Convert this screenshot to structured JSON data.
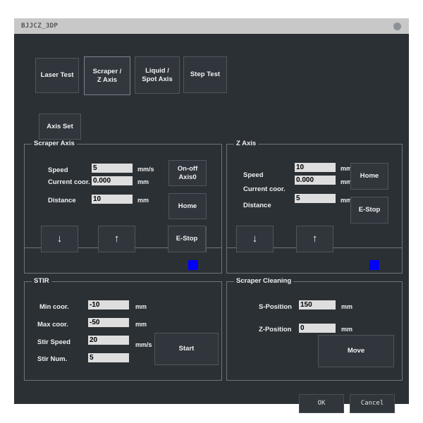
{
  "window": {
    "title": "BJJCZ_3DP",
    "titlebar_button": "titlebar-dot"
  },
  "tabs": [
    {
      "label": "Laser Test",
      "selected": false
    },
    {
      "label": "Scraper /\nZ Axis",
      "selected": true
    },
    {
      "label": "Liquid /\nSpot Axis",
      "selected": false
    },
    {
      "label": "Step Test",
      "selected": false
    }
  ],
  "toolbar": {
    "axis_set_label": "Axis Set"
  },
  "scraper_axis": {
    "title": "Scraper Axis",
    "speed_label": "Speed",
    "speed_value": "5",
    "speed_unit": "mm/s",
    "current_coor_label": "Current coor.",
    "current_coor_value": "0.000",
    "current_coor_unit": "mm",
    "distance_label": "Distance",
    "distance_value": "10",
    "distance_unit": "mm",
    "onoff_label": "On-off\nAxis0",
    "home_label": "Home",
    "estop_label": "E-Stop",
    "down_arrow": "↓",
    "up_arrow": "↑",
    "indicator_color": "#0000ff"
  },
  "z_axis": {
    "title": "Z Axis",
    "speed_label": "Speed",
    "speed_value": "10",
    "speed_unit": "mm/s",
    "current_coor_label": "Current coor.",
    "current_coor_value": "0.000",
    "current_coor_unit": "mm",
    "distance_label": "Distance",
    "distance_value": "5",
    "distance_unit": "mm",
    "home_label": "Home",
    "estop_label": "E-Stop",
    "down_arrow": "↓",
    "up_arrow": "↑",
    "indicator_color": "#0000ff"
  },
  "stir": {
    "title": "STIR",
    "min_coor_label": "Min coor.",
    "min_coor_value": "-10",
    "min_coor_unit": "mm",
    "max_coor_label": "Max coor.",
    "max_coor_value": "-50",
    "max_coor_unit": "mm",
    "stir_speed_label": "Stir Speed",
    "stir_speed_value": "20",
    "stir_speed_unit": "mm/s",
    "stir_num_label": "Stir Num.",
    "stir_num_value": "5",
    "start_label": "Start"
  },
  "scraper_cleaning": {
    "title": "Scraper Cleaning",
    "s_position_label": "S-Position",
    "s_position_value": "150",
    "s_position_unit": "mm",
    "z_position_label": "Z-Position",
    "z_position_value": "0",
    "z_position_unit": "mm",
    "move_label": "Move"
  },
  "dialog_buttons": {
    "ok_label": "OK",
    "cancel_label": "Cancel"
  }
}
